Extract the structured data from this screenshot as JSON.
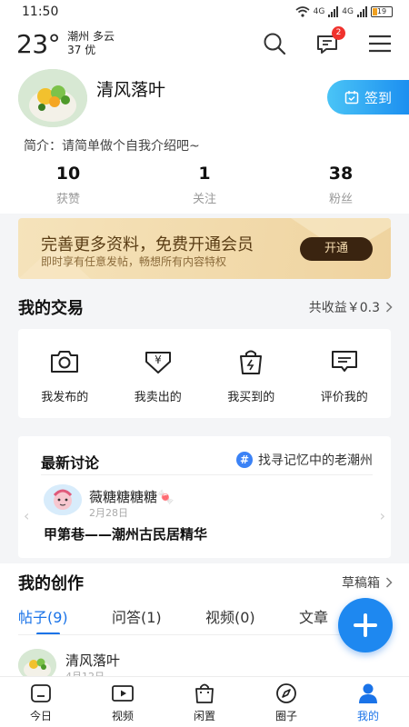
{
  "status": {
    "time": "11:50",
    "net1": "4G",
    "net2": "4G",
    "battery": "19"
  },
  "header": {
    "temperature": "23°",
    "city_weather": "潮州 多云",
    "aqi": "37 优",
    "notification_count": "2"
  },
  "profile": {
    "name": "清风落叶",
    "signin_label": "签到",
    "intro": "简介：请简单做个自我介绍吧~",
    "stats": [
      {
        "value": "10",
        "label": "获赞"
      },
      {
        "value": "1",
        "label": "关注"
      },
      {
        "value": "38",
        "label": "粉丝"
      }
    ]
  },
  "vip": {
    "title": "完善更多资料，免费开通会员",
    "subtitle": "即时享有任意发帖，畅想所有内容特权",
    "button": "开通"
  },
  "trade": {
    "title": "我的交易",
    "earnings": "共收益￥0.3",
    "items": [
      {
        "label": "我发布的",
        "icon": "camera-icon"
      },
      {
        "label": "我卖出的",
        "icon": "yen-tag-icon"
      },
      {
        "label": "我买到的",
        "icon": "bag-icon"
      },
      {
        "label": "评价我的",
        "icon": "comment-icon"
      }
    ]
  },
  "discussion": {
    "title": "最新讨论",
    "topic": "找寻记忆中的老潮州",
    "user": "薇糖糖糖糖🍬",
    "date": "2月28日",
    "text": "甲第巷——潮州古民居精华"
  },
  "creation": {
    "title": "我的创作",
    "drafts": "草稿箱",
    "tabs": [
      "帖子(9)",
      "问答(1)",
      "视频(0)",
      "文章"
    ],
    "post_user": "清风落叶",
    "post_date": "4月12日"
  },
  "nav": [
    {
      "label": "今日",
      "icon": "home-icon"
    },
    {
      "label": "视频",
      "icon": "video-icon"
    },
    {
      "label": "闲置",
      "icon": "shopping-bag-icon"
    },
    {
      "label": "圈子",
      "icon": "compass-icon"
    },
    {
      "label": "我的",
      "icon": "person-icon"
    }
  ],
  "colors": {
    "accent": "#1a73e8",
    "vip_bg": "#f2dcad",
    "badge": "#f0322d"
  }
}
